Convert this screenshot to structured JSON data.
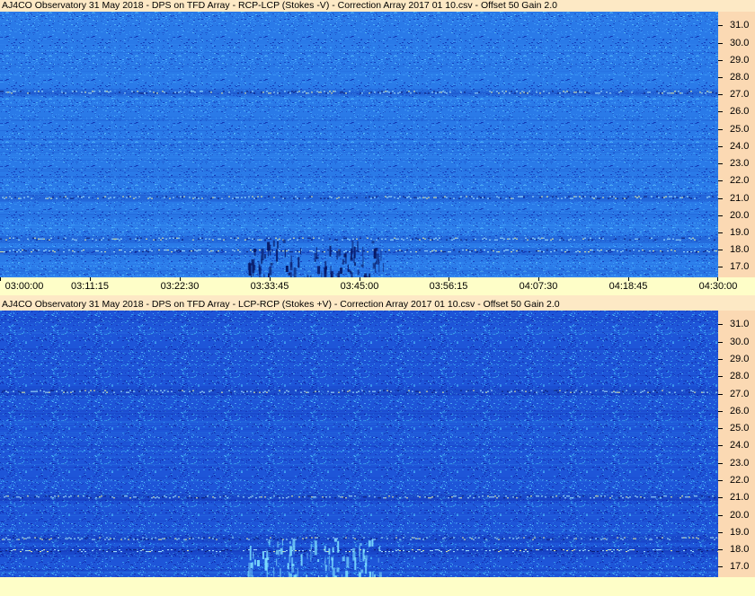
{
  "panels": [
    {
      "id": "top",
      "title": "AJ4CO Observatory 31 May 2018  -  DPS on TFD Array  -  RCP-LCP (Stokes -V)  -  Correction Array 2017 01 10.csv  -  Offset 50  Gain 2.0",
      "colors": {
        "base": "#2a7ae8",
        "light": "#46a8ff",
        "dark": "#0e2fb0"
      }
    },
    {
      "id": "bottom",
      "title": "AJ4CO Observatory 31 May 2018  -  DPS on TFD Array  -  LCP-RCP (Stokes +V)  -  Correction Array 2017 01 10.csv  -  Offset 50  Gain 2.0",
      "colors": {
        "base": "#1e55d8",
        "light": "#3da8f2",
        "dark": "#0c1fa0"
      }
    }
  ],
  "chart_data": {
    "type": "heatmap",
    "y_ticks": [
      "31.0",
      "30.0",
      "29.0",
      "28.0",
      "27.0",
      "26.0",
      "25.0",
      "24.0",
      "23.0",
      "22.0",
      "21.0",
      "20.0",
      "19.0",
      "18.0",
      "17.0"
    ],
    "x_ticks": [
      "03:00:00",
      "03:11:15",
      "03:22:30",
      "03:33:45",
      "03:45:00",
      "03:56:15",
      "04:07:30",
      "04:18:45",
      "04:30:00"
    ],
    "x_range": [
      "03:00:00",
      "04:30:00"
    ],
    "y_range": [
      16.4,
      31.8
    ],
    "features": [
      {
        "kind": "interference_band",
        "freq": 27.1
      },
      {
        "kind": "interference_band",
        "freq": 21.0
      },
      {
        "kind": "interference_band",
        "freq": 18.6
      },
      {
        "kind": "interference_band",
        "freq": 17.9
      },
      {
        "kind": "burst",
        "time_start": "03:31:00",
        "time_end": "03:48:00",
        "freq_low": 16.4,
        "freq_high": 18.6
      }
    ]
  }
}
